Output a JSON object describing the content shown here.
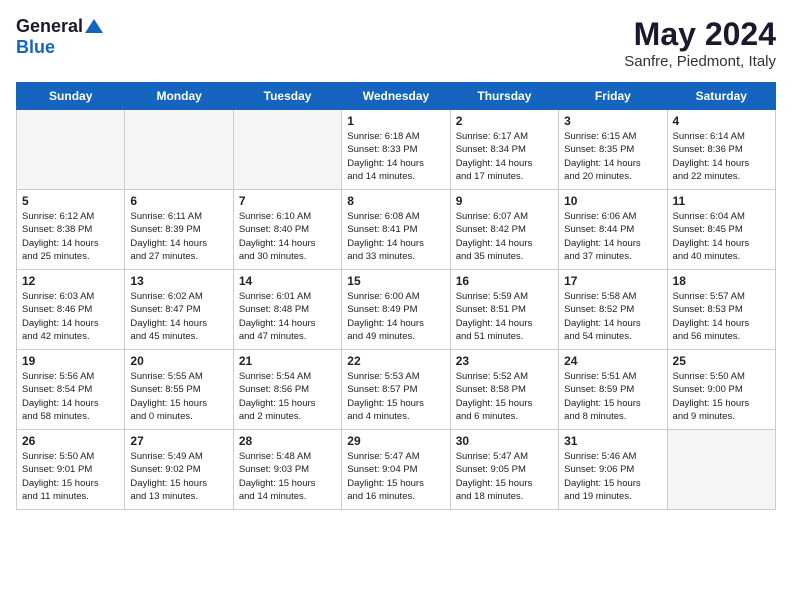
{
  "logo": {
    "general": "General",
    "blue": "Blue"
  },
  "header": {
    "title": "May 2024",
    "subtitle": "Sanfre, Piedmont, Italy"
  },
  "weekdays": [
    "Sunday",
    "Monday",
    "Tuesday",
    "Wednesday",
    "Thursday",
    "Friday",
    "Saturday"
  ],
  "weeks": [
    [
      {
        "day": "",
        "info": ""
      },
      {
        "day": "",
        "info": ""
      },
      {
        "day": "",
        "info": ""
      },
      {
        "day": "1",
        "info": "Sunrise: 6:18 AM\nSunset: 8:33 PM\nDaylight: 14 hours\nand 14 minutes."
      },
      {
        "day": "2",
        "info": "Sunrise: 6:17 AM\nSunset: 8:34 PM\nDaylight: 14 hours\nand 17 minutes."
      },
      {
        "day": "3",
        "info": "Sunrise: 6:15 AM\nSunset: 8:35 PM\nDaylight: 14 hours\nand 20 minutes."
      },
      {
        "day": "4",
        "info": "Sunrise: 6:14 AM\nSunset: 8:36 PM\nDaylight: 14 hours\nand 22 minutes."
      }
    ],
    [
      {
        "day": "5",
        "info": "Sunrise: 6:12 AM\nSunset: 8:38 PM\nDaylight: 14 hours\nand 25 minutes."
      },
      {
        "day": "6",
        "info": "Sunrise: 6:11 AM\nSunset: 8:39 PM\nDaylight: 14 hours\nand 27 minutes."
      },
      {
        "day": "7",
        "info": "Sunrise: 6:10 AM\nSunset: 8:40 PM\nDaylight: 14 hours\nand 30 minutes."
      },
      {
        "day": "8",
        "info": "Sunrise: 6:08 AM\nSunset: 8:41 PM\nDaylight: 14 hours\nand 33 minutes."
      },
      {
        "day": "9",
        "info": "Sunrise: 6:07 AM\nSunset: 8:42 PM\nDaylight: 14 hours\nand 35 minutes."
      },
      {
        "day": "10",
        "info": "Sunrise: 6:06 AM\nSunset: 8:44 PM\nDaylight: 14 hours\nand 37 minutes."
      },
      {
        "day": "11",
        "info": "Sunrise: 6:04 AM\nSunset: 8:45 PM\nDaylight: 14 hours\nand 40 minutes."
      }
    ],
    [
      {
        "day": "12",
        "info": "Sunrise: 6:03 AM\nSunset: 8:46 PM\nDaylight: 14 hours\nand 42 minutes."
      },
      {
        "day": "13",
        "info": "Sunrise: 6:02 AM\nSunset: 8:47 PM\nDaylight: 14 hours\nand 45 minutes."
      },
      {
        "day": "14",
        "info": "Sunrise: 6:01 AM\nSunset: 8:48 PM\nDaylight: 14 hours\nand 47 minutes."
      },
      {
        "day": "15",
        "info": "Sunrise: 6:00 AM\nSunset: 8:49 PM\nDaylight: 14 hours\nand 49 minutes."
      },
      {
        "day": "16",
        "info": "Sunrise: 5:59 AM\nSunset: 8:51 PM\nDaylight: 14 hours\nand 51 minutes."
      },
      {
        "day": "17",
        "info": "Sunrise: 5:58 AM\nSunset: 8:52 PM\nDaylight: 14 hours\nand 54 minutes."
      },
      {
        "day": "18",
        "info": "Sunrise: 5:57 AM\nSunset: 8:53 PM\nDaylight: 14 hours\nand 56 minutes."
      }
    ],
    [
      {
        "day": "19",
        "info": "Sunrise: 5:56 AM\nSunset: 8:54 PM\nDaylight: 14 hours\nand 58 minutes."
      },
      {
        "day": "20",
        "info": "Sunrise: 5:55 AM\nSunset: 8:55 PM\nDaylight: 15 hours\nand 0 minutes."
      },
      {
        "day": "21",
        "info": "Sunrise: 5:54 AM\nSunset: 8:56 PM\nDaylight: 15 hours\nand 2 minutes."
      },
      {
        "day": "22",
        "info": "Sunrise: 5:53 AM\nSunset: 8:57 PM\nDaylight: 15 hours\nand 4 minutes."
      },
      {
        "day": "23",
        "info": "Sunrise: 5:52 AM\nSunset: 8:58 PM\nDaylight: 15 hours\nand 6 minutes."
      },
      {
        "day": "24",
        "info": "Sunrise: 5:51 AM\nSunset: 8:59 PM\nDaylight: 15 hours\nand 8 minutes."
      },
      {
        "day": "25",
        "info": "Sunrise: 5:50 AM\nSunset: 9:00 PM\nDaylight: 15 hours\nand 9 minutes."
      }
    ],
    [
      {
        "day": "26",
        "info": "Sunrise: 5:50 AM\nSunset: 9:01 PM\nDaylight: 15 hours\nand 11 minutes."
      },
      {
        "day": "27",
        "info": "Sunrise: 5:49 AM\nSunset: 9:02 PM\nDaylight: 15 hours\nand 13 minutes."
      },
      {
        "day": "28",
        "info": "Sunrise: 5:48 AM\nSunset: 9:03 PM\nDaylight: 15 hours\nand 14 minutes."
      },
      {
        "day": "29",
        "info": "Sunrise: 5:47 AM\nSunset: 9:04 PM\nDaylight: 15 hours\nand 16 minutes."
      },
      {
        "day": "30",
        "info": "Sunrise: 5:47 AM\nSunset: 9:05 PM\nDaylight: 15 hours\nand 18 minutes."
      },
      {
        "day": "31",
        "info": "Sunrise: 5:46 AM\nSunset: 9:06 PM\nDaylight: 15 hours\nand 19 minutes."
      },
      {
        "day": "",
        "info": ""
      }
    ]
  ]
}
